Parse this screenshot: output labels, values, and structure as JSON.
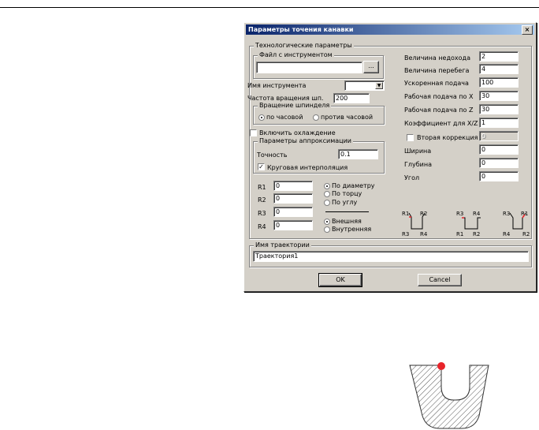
{
  "dialog": {
    "title": "Параметры точения канавки",
    "close_glyph": "×",
    "tech_group": "Технологические параметры",
    "tool_file_group": "Файл с инструментом",
    "browse_label": "...",
    "tool_name_label": "Имя инструмента",
    "spindle_speed_label": "Частота вращения шп.",
    "spindle_speed_value": "200",
    "spindle_rotation_group": "Вращение шпинделя",
    "rotation_cw": "по часовой",
    "rotation_ccw": "против часовой",
    "cooling_label": "Включить охлаждение",
    "approx_group": "Параметры аппроксимации",
    "accuracy_label": "Точность",
    "accuracy_value": "0.1",
    "circular_interp_label": "Круговая интерполяция",
    "right": {
      "undercut_label": "Величина недохода",
      "undercut_value": "2",
      "overrun_label": "Величина перебега",
      "overrun_value": "4",
      "rapid_feed_label": "Ускоренная подача",
      "rapid_feed_value": "100",
      "feed_x_label": "Рабочая подача по X",
      "feed_x_value": "30",
      "feed_z_label": "Рабочая подача по Z",
      "feed_z_value": "30",
      "coef_label": "Коэффициент для X/Z",
      "coef_value": "1",
      "second_corr_label": "Вторая коррекция",
      "second_corr_value": "0",
      "width_label": "Ширина",
      "width_value": "0",
      "depth_label": "Глубина",
      "depth_value": "0",
      "angle_label": "Угол",
      "angle_value": "0"
    },
    "radii": [
      {
        "label": "R1",
        "value": "0"
      },
      {
        "label": "R2",
        "value": "0"
      },
      {
        "label": "R3",
        "value": "0"
      },
      {
        "label": "R4",
        "value": "0"
      }
    ],
    "position": {
      "by_diameter": "По диаметру",
      "by_face": "По торцу",
      "by_angle": "По углу",
      "outer": "Внешняя",
      "inner": "Внутренняя"
    },
    "schemes": [
      {
        "tl": "R1",
        "tr": "R2",
        "bl": "R3",
        "br": "R4"
      },
      {
        "tl": "R3",
        "tr": "R4",
        "bl": "R1",
        "br": "R2"
      },
      {
        "tl": "R3",
        "tr": "R1",
        "bl": "R4",
        "br": "R2"
      }
    ],
    "trajectory_group": "Имя траектории",
    "trajectory_value": "Траектория1",
    "ok_label": "OK",
    "cancel_label": "Cancel"
  },
  "colors": {
    "dialog_bg": "#d4d0c8",
    "title_start": "#0a246a",
    "title_end": "#a6caf0",
    "marker_red": "#e8242a",
    "hatch": "#555555"
  }
}
